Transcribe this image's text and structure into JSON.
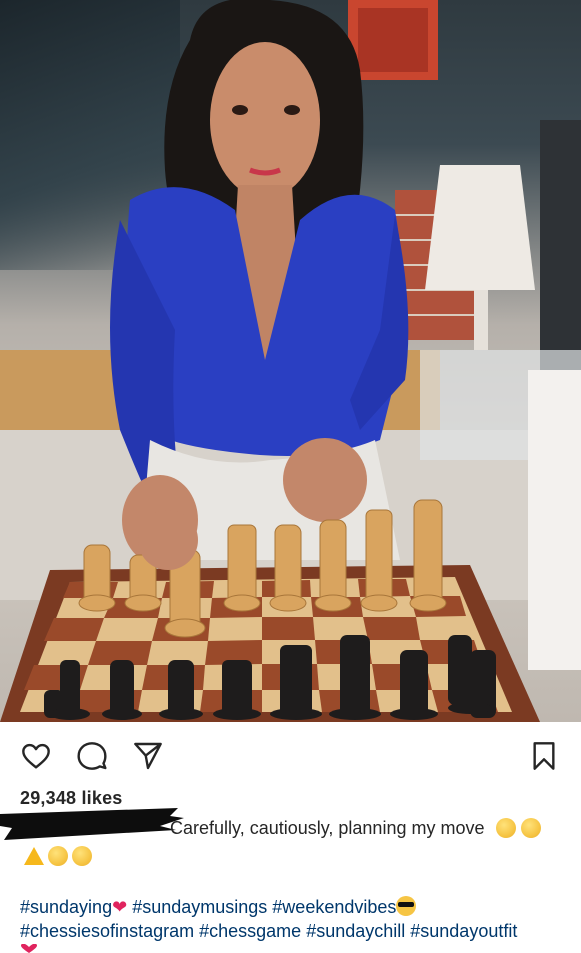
{
  "post": {
    "likes_text": "29,348 likes",
    "caption_text": "Carefully, cautiously, planning my move",
    "hashtag_lines": [
      [
        "#sundaying",
        "#sundaymusings",
        "#weekendvibes"
      ],
      [
        "#chessiesofinstagram",
        "#chessgame",
        "#sundaychill",
        "#sundayoutfit"
      ]
    ],
    "line1_tags": {
      "t1": "#sundaying",
      "t2": "#sundaymusings",
      "t3": "#weekendvibes"
    },
    "line2_tags": {
      "t1": "#chessiesofinstagram",
      "t2": "#chessgame",
      "t3": "#sundaychill",
      "t4": "#sundayoutfit"
    },
    "heart_emoji": "❤"
  },
  "actions": {
    "like_icon": "heart-outline-icon",
    "comment_icon": "comment-bubble-icon",
    "share_icon": "paper-plane-icon",
    "save_icon": "bookmark-icon"
  },
  "colors": {
    "text": "#262626",
    "hashtag": "#00376b",
    "heart": "#e0245e"
  }
}
